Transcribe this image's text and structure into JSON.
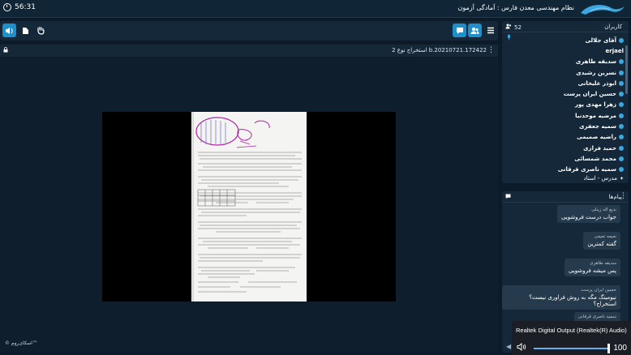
{
  "header": {
    "timer": "56:31",
    "title": "نظام مهندسی معدن فارس : آمادگی آزمون"
  },
  "toolbar": {
    "icons": [
      "speaker-icon",
      "file-icon",
      "hand-icon",
      "chat-icon",
      "users-icon",
      "menu-icon"
    ]
  },
  "presentation": {
    "title": "استخراج نوع 2 b.20210721.172422",
    "watermark": "© اسکای‌روم™",
    "doc_heading": "سوالات آزمون استخراج معدن ۔ فارس نوبت ۲",
    "doc_handwriting": "ارثه"
  },
  "users": {
    "title": "کاربران",
    "count": "52",
    "list": [
      "آقای جلالی",
      "erjael",
      "سدیقه طاهری",
      "نسرین رشیدی",
      "ابوذر علیخانی",
      "حسین ایران پرست",
      "زهرا مهدی پور",
      "مرضیه موحدنیا",
      "سمیه جعفری",
      "راضیه صمیمی",
      "حمید فرازی",
      "محمد شمسائی",
      "سمیه ناصری قرقانی",
      "مدرس - استاد"
    ]
  },
  "chat": {
    "title": "پیام‌ها",
    "messages": [
      {
        "sender": "بدیع اله زینلی",
        "text": "جواب درست فروشویی"
      },
      {
        "sender": "نعیمه نعیمی",
        "text": "گفته کمترین"
      },
      {
        "sender": "سدیقه طاهری",
        "text": "پس میشه فروشویی"
      },
      {
        "sender": "حسین ایران پرست",
        "text": "نیومینگ مگه به روش فراوری نیست؟استخراج؟"
      },
      {
        "sender": "سمیه ناصری قرقانی",
        "text": ""
      }
    ]
  },
  "audio": {
    "device": "Realtek Digital Output (Realtek(R) Audio)",
    "volume": "100",
    "volume_level": 1.0
  },
  "colors": {
    "accent": "#1f8fc9",
    "background": "#0b1b2a",
    "panel": "#14283a"
  }
}
